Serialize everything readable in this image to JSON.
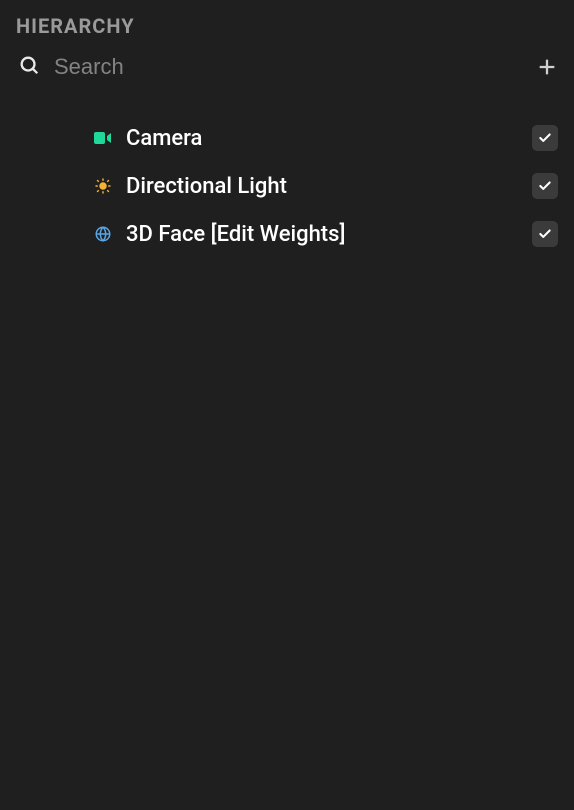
{
  "panel": {
    "title": "HIERARCHY"
  },
  "search": {
    "placeholder": "Search",
    "value": ""
  },
  "items": [
    {
      "icon": "camera",
      "label": "Camera",
      "checked": true
    },
    {
      "icon": "light",
      "label": "Directional Light",
      "checked": true
    },
    {
      "icon": "globe",
      "label": "3D Face [Edit Weights]",
      "checked": true
    }
  ]
}
